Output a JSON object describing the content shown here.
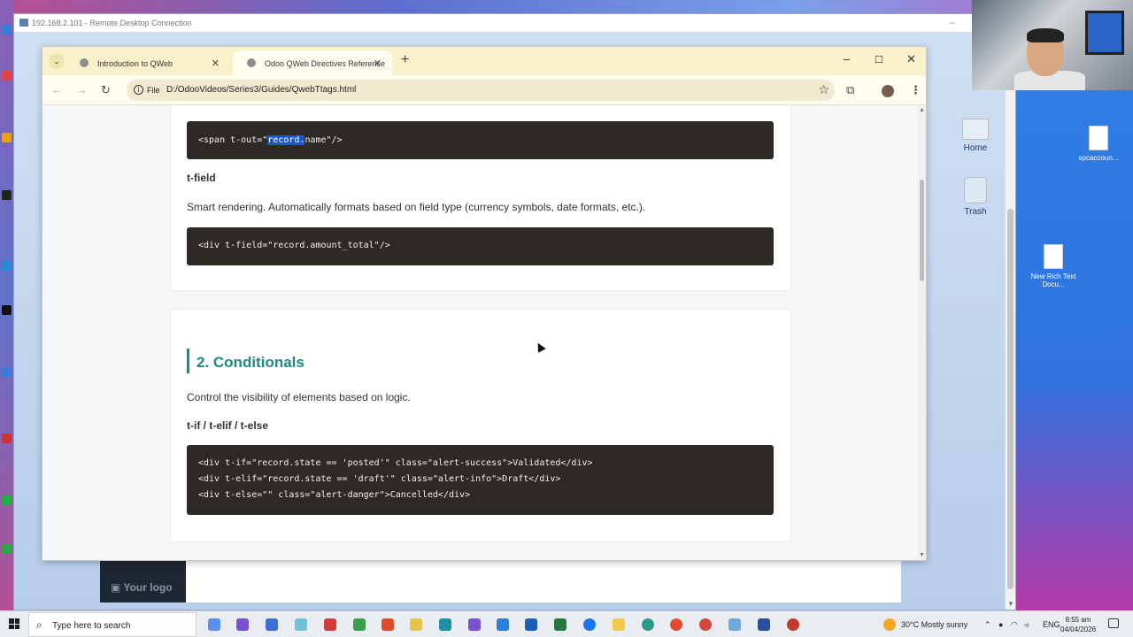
{
  "rdp": {
    "title": "192.168.2.101 - Remote Desktop Connection"
  },
  "remote_desktop_icons": [
    {
      "label": "Home"
    },
    {
      "label": "Trash"
    }
  ],
  "behind_page": {
    "logo_text": "Your logo"
  },
  "browser": {
    "tabs": [
      {
        "title": "Introduction to QWeb",
        "active": false
      },
      {
        "title": "Odoo QWeb Directives Reference",
        "active": true
      }
    ],
    "address": {
      "scheme": "File",
      "url": "D:/OdooVideos/Series3/Guides/QwebTtags.html"
    }
  },
  "page": {
    "card1": {
      "code_out_before": "<span t-out=\"",
      "code_out_selected": "record.",
      "code_out_after": "name\"/>",
      "t_field_heading": "t-field",
      "t_field_desc": "Smart rendering. Automatically formats based on field type (currency symbols, date formats, etc.).",
      "t_field_code": "<div t-field=\"record.amount_total\"/>"
    },
    "card2": {
      "title": "2. Conditionals",
      "desc": "Control the visibility of elements based on logic.",
      "subheading": "t-if / t-elif / t-else",
      "code_lines": [
        "<div t-if=\"record.state == 'posted'\" class=\"alert-success\">Validated</div>",
        "<div t-elif=\"record.state == 'draft'\" class=\"alert-info\">Draft</div>",
        "<div t-else=\"\" class=\"alert-danger\">Cancelled</div>"
      ]
    }
  },
  "local_desktop_icons": [
    {
      "label": "spcaccoun..."
    },
    {
      "label": "New Rich Text Docu..."
    }
  ],
  "taskbar": {
    "search_placeholder": "Type here to search",
    "weather": "30°C  Mostly sunny",
    "language": "ENG",
    "time": "8:55 am",
    "date": "04/04/2026"
  },
  "colors": {
    "accent_teal": "#1f8a7e",
    "code_bg": "#2d2a26",
    "selection": "#1e57c8",
    "tab_bar": "#f8f1c9"
  }
}
